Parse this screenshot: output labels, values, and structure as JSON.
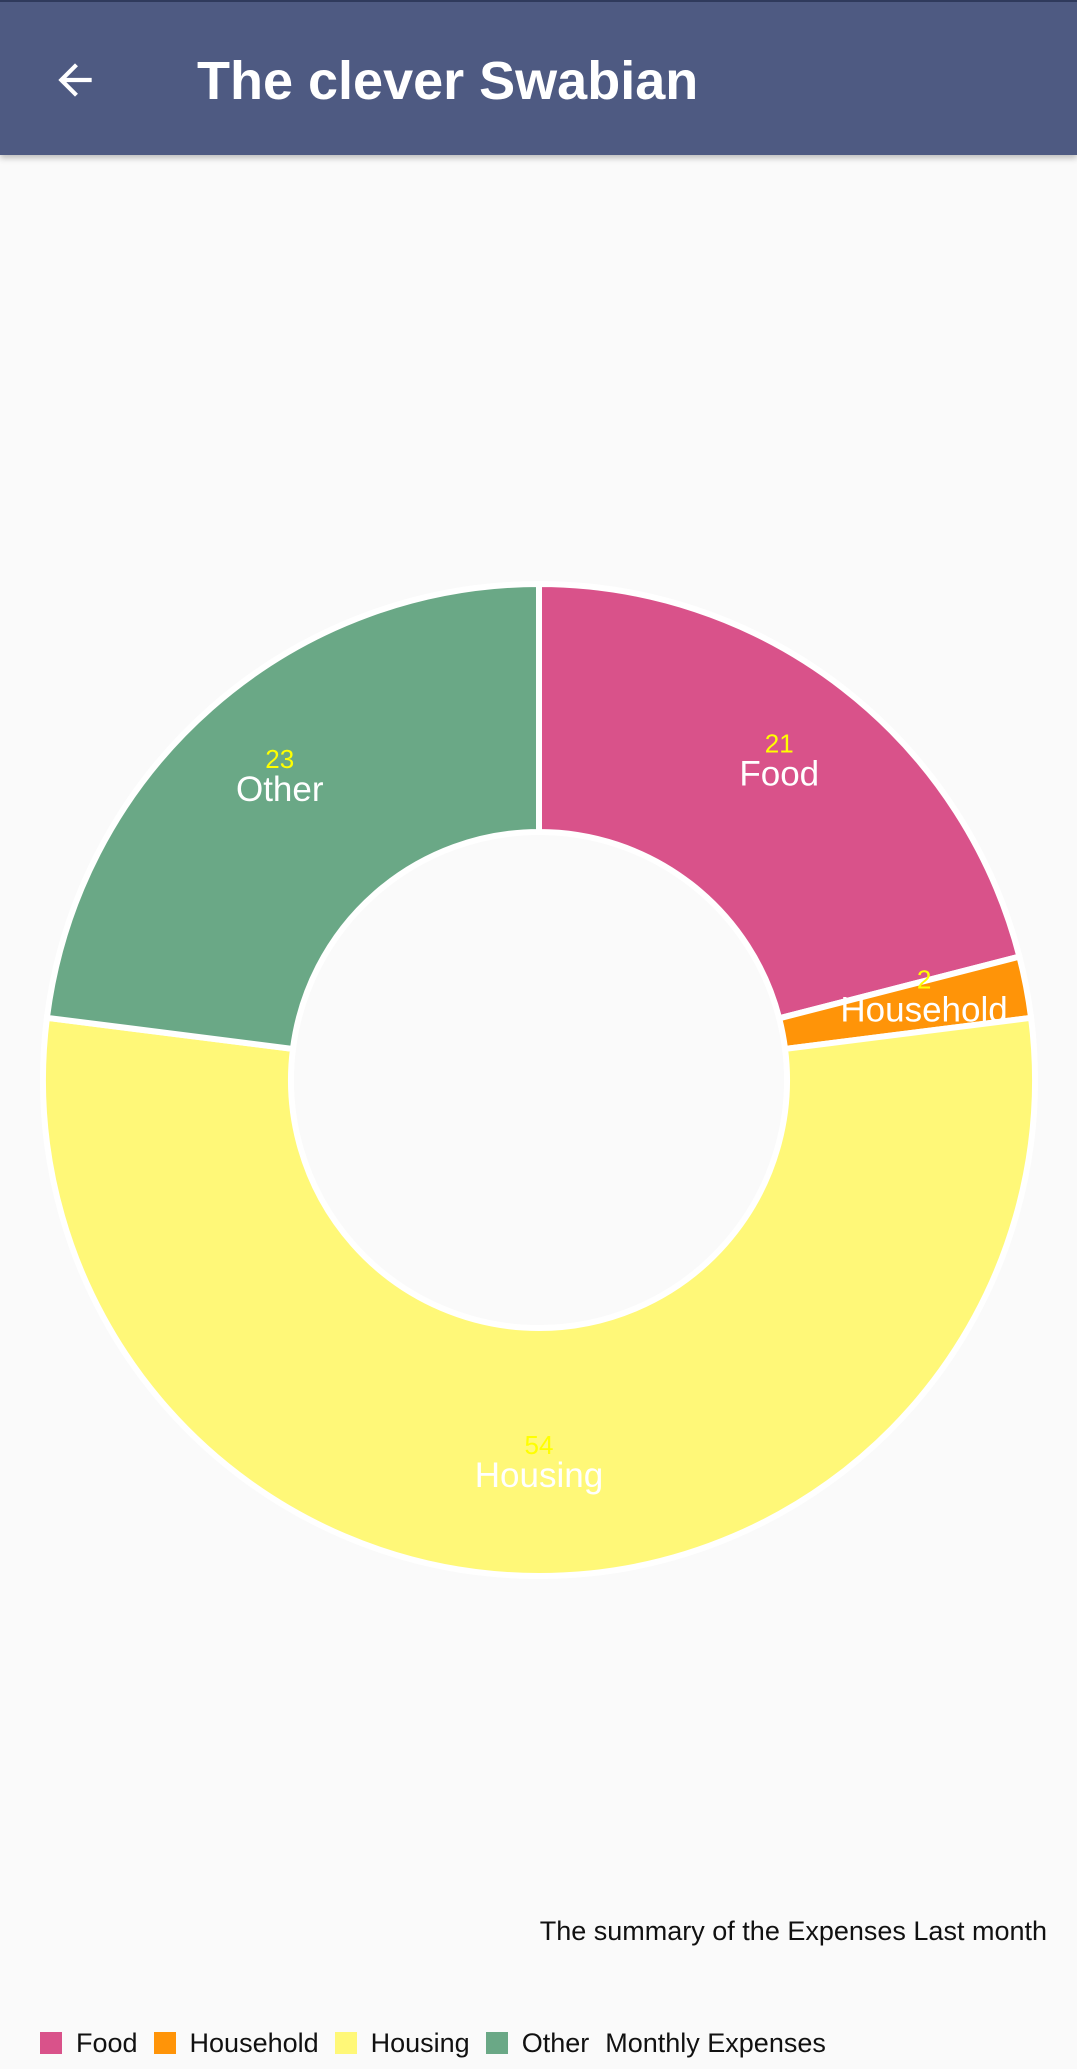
{
  "app_bar": {
    "title": "The clever Swabian",
    "back_icon": "arrow-left-icon"
  },
  "chart_data": {
    "type": "pie",
    "hole": true,
    "title": "",
    "description": "The summary of the Expenses Last month",
    "legend_suffix": "Monthly Expenses",
    "legend_position": "bottom-left",
    "slices": [
      {
        "label": "Food",
        "value": 21,
        "color": "#d9528a"
      },
      {
        "label": "Household",
        "value": 2,
        "color": "#ff9408"
      },
      {
        "label": "Housing",
        "value": 54,
        "color": "#fff878"
      },
      {
        "label": "Other",
        "value": 23,
        "color": "#6aa886"
      }
    ],
    "value_text_color": "#ffff00",
    "label_text_color": "#ffffff"
  }
}
